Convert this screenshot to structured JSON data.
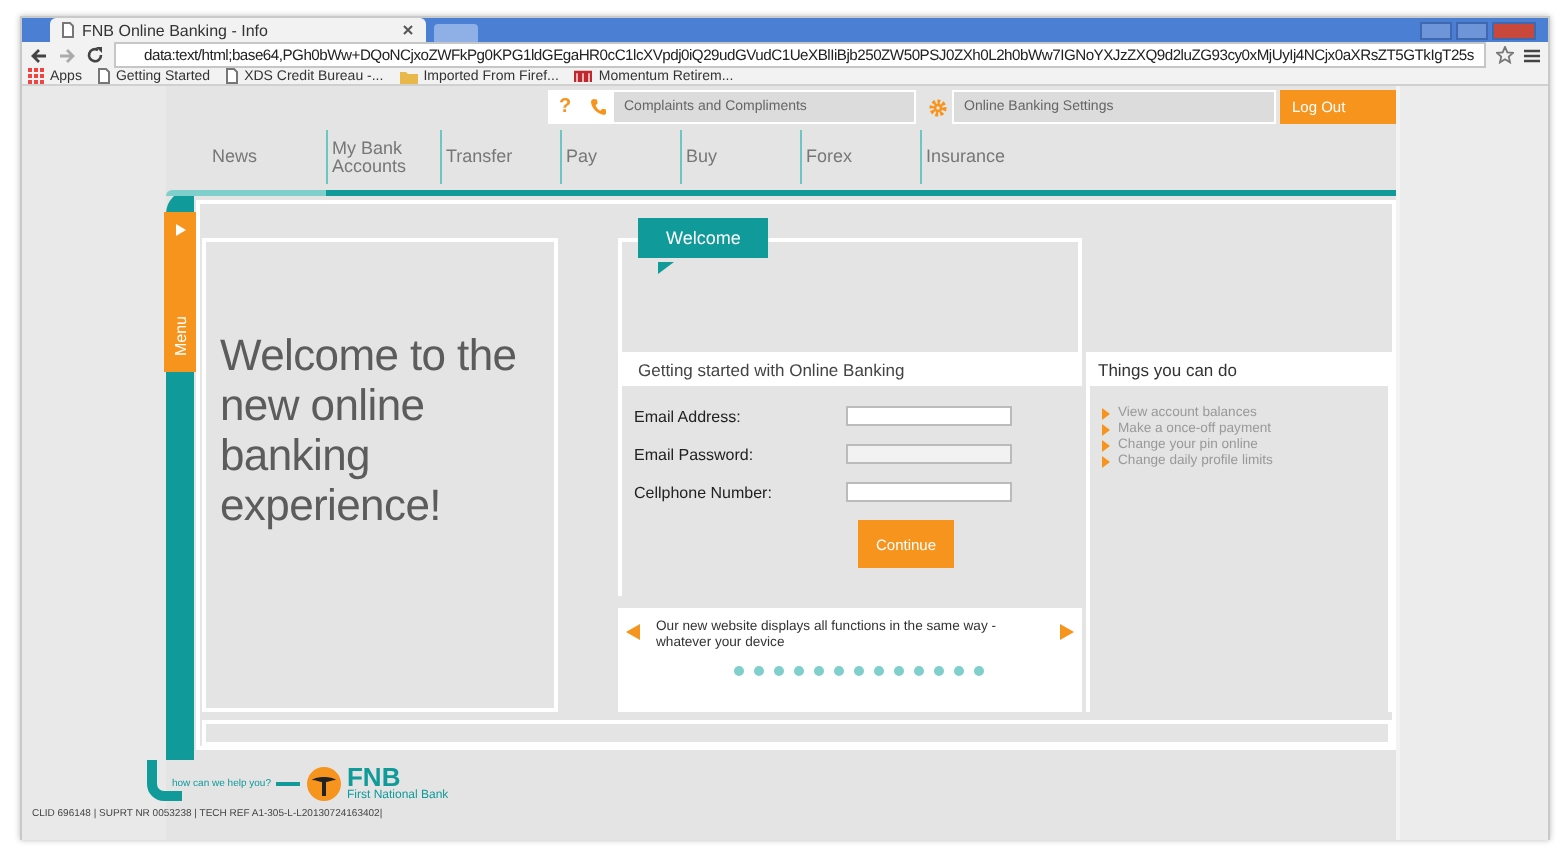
{
  "browser": {
    "tab_title": "FNB Online Banking - Info",
    "url": "data:text/html;base64,PGh0bWw+DQoNCjxoZWFkPg0KPG1ldGEgaHR0cC1lcXVpdj0iQ29udGVudC1UeXBlIiBjb250ZW50PSJ0ZXh0L2h0bWw7IGNoYXJzZXQ9d2luZG93cy0xMjUyIj4NCjx0aXRsZT5GTkIgT25s",
    "bookmarks": [
      {
        "kind": "apps",
        "label": "Apps"
      },
      {
        "kind": "page",
        "label": "Getting Started"
      },
      {
        "kind": "page",
        "label": "XDS Credit Bureau -..."
      },
      {
        "kind": "folder",
        "label": "Imported From Firef..."
      },
      {
        "kind": "brand",
        "label": "Momentum Retirem..."
      }
    ]
  },
  "top_bar": {
    "help": "?",
    "complaints": "Complaints and Compliments",
    "settings": "Online Banking Settings",
    "logout": "Log Out"
  },
  "nav": [
    "News",
    "My Bank Accounts",
    "Transfer",
    "Pay",
    "Buy",
    "Forex",
    "Insurance"
  ],
  "menu_tab": "Menu",
  "welcome_heading": "Welcome to the new online banking experience!",
  "welcome_tab": "Welcome",
  "form": {
    "title": "Getting started with Online Banking",
    "fields": [
      {
        "label": "Email Address:"
      },
      {
        "label": "Email Password:"
      },
      {
        "label": "Cellphone Number:"
      }
    ],
    "button": "Continue"
  },
  "things": {
    "title": "Things you can do",
    "items": [
      "View account balances",
      "Make a once-off payment",
      "Change your pin online",
      "Change daily profile limits"
    ]
  },
  "carousel": {
    "text": "Our new website displays all functions in the same way - whatever your device"
  },
  "footer": {
    "help_text": "how can we help you?",
    "logo": "FNB",
    "logo_sub": "First National Bank",
    "refs": "CLID 696148 | SUPRT NR 0053238 | TECH REF A1-305-L-L20130724163402|"
  }
}
